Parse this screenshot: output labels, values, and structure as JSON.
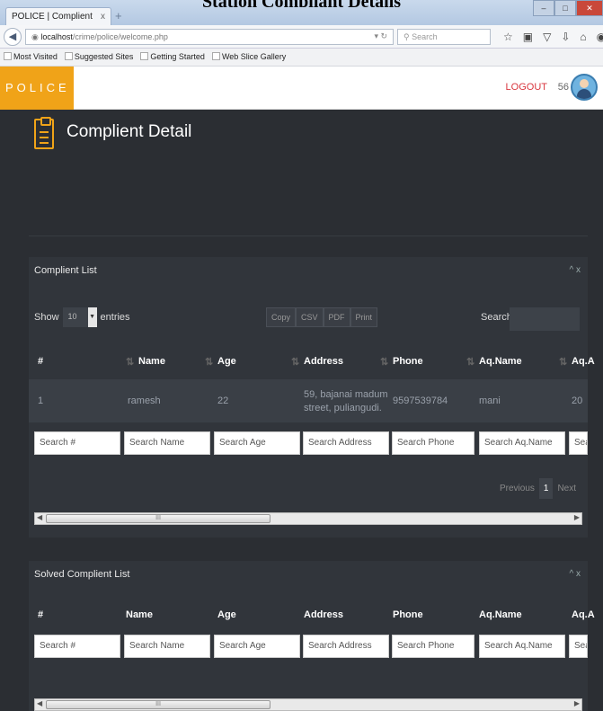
{
  "doc_title": "Station Compliant Details",
  "browser": {
    "tab_title": "POLICE | Complient",
    "tab_close": "x",
    "new_tab": "+",
    "url_host": "localhost",
    "url_path": "/crime/police/welcome.php",
    "search_placeholder": "Search",
    "bookmarks": [
      "Most Visited",
      "Suggested Sites",
      "Getting Started",
      "Web Slice Gallery"
    ]
  },
  "header": {
    "brand": "POLICE",
    "logout": "LOGOUT",
    "user_number": "56"
  },
  "page": {
    "title": "Complient Detail"
  },
  "complaint_panel": {
    "title": "Complient List",
    "controls": "^ x",
    "show_label": "Show",
    "entries_value": "10",
    "entries_label": "entries",
    "buttons": [
      "Copy",
      "CSV",
      "PDF",
      "Print"
    ],
    "search_label": "Search:",
    "columns": [
      "#",
      "Name",
      "Age",
      "Address",
      "Phone",
      "Aq.Name",
      "Aq.A"
    ],
    "rows": [
      [
        "1",
        "ramesh",
        "22",
        "59, bajanai madum street, puliangudi.",
        "9597539784",
        "mani",
        "20"
      ]
    ],
    "filters": [
      "Search #",
      "Search Name",
      "Search Age",
      "Search Address",
      "Search Phone",
      "Search Aq.Name",
      "Sear"
    ],
    "pager": {
      "previous": "Previous",
      "current": "1",
      "next": "Next"
    },
    "scroll_grip": "III"
  },
  "solved_panel": {
    "title": "Solved Complient List",
    "controls": "^ x",
    "columns": [
      "#",
      "Name",
      "Age",
      "Address",
      "Phone",
      "Aq.Name",
      "Aq.A"
    ],
    "filters": [
      "Search #",
      "Search Name",
      "Search Age",
      "Search Address",
      "Search Phone",
      "Search Aq.Name",
      "Sear"
    ],
    "scroll_grip": "III"
  },
  "colors": {
    "accent": "#f0a318",
    "logout": "#d9363e",
    "content_bg": "#2b2e33",
    "panel_bg": "#31353b"
  }
}
